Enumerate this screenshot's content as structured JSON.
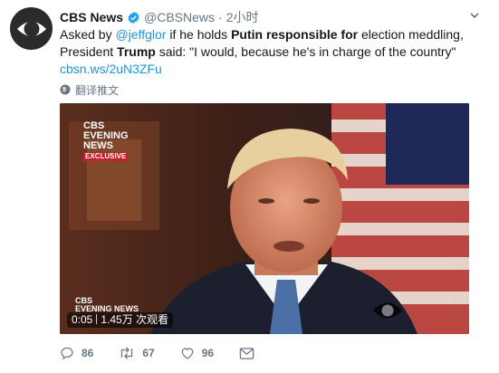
{
  "account": {
    "name": "CBS News",
    "handle": "@CBSNews",
    "separator": "·",
    "time": "2小时"
  },
  "tweet": {
    "t1": "Asked by ",
    "mention": "@jeffglor",
    "t2": " if he holds ",
    "b1": "Putin responsible for",
    "t3": " election meddling,",
    "t4": "President ",
    "b2": "Trump",
    "t5": " said: \"I would, because he's in charge of the country\"",
    "url": "cbsn.ws/2uN3ZFu"
  },
  "translate_label": "翻译推文",
  "video": {
    "corner_logo_lines": [
      "CBS",
      "EVENING",
      "NEWS",
      "EXCLUSIVE"
    ],
    "lower_logo_lines": [
      "CBS",
      "EVENING NEWS"
    ],
    "duration": "0:05",
    "views": "1.45万 次观看"
  },
  "actions": {
    "replies": "86",
    "retweets": "67",
    "likes": "96"
  },
  "colors": {
    "link": "#1b95e0",
    "muted": "#657786",
    "verified": "#1da1f2"
  },
  "icons": [
    "cbs-eye-logo-icon",
    "verified-badge-icon",
    "chevron-down-icon",
    "globe-icon",
    "reply-icon",
    "retweet-icon",
    "like-icon",
    "direct-message-icon"
  ]
}
